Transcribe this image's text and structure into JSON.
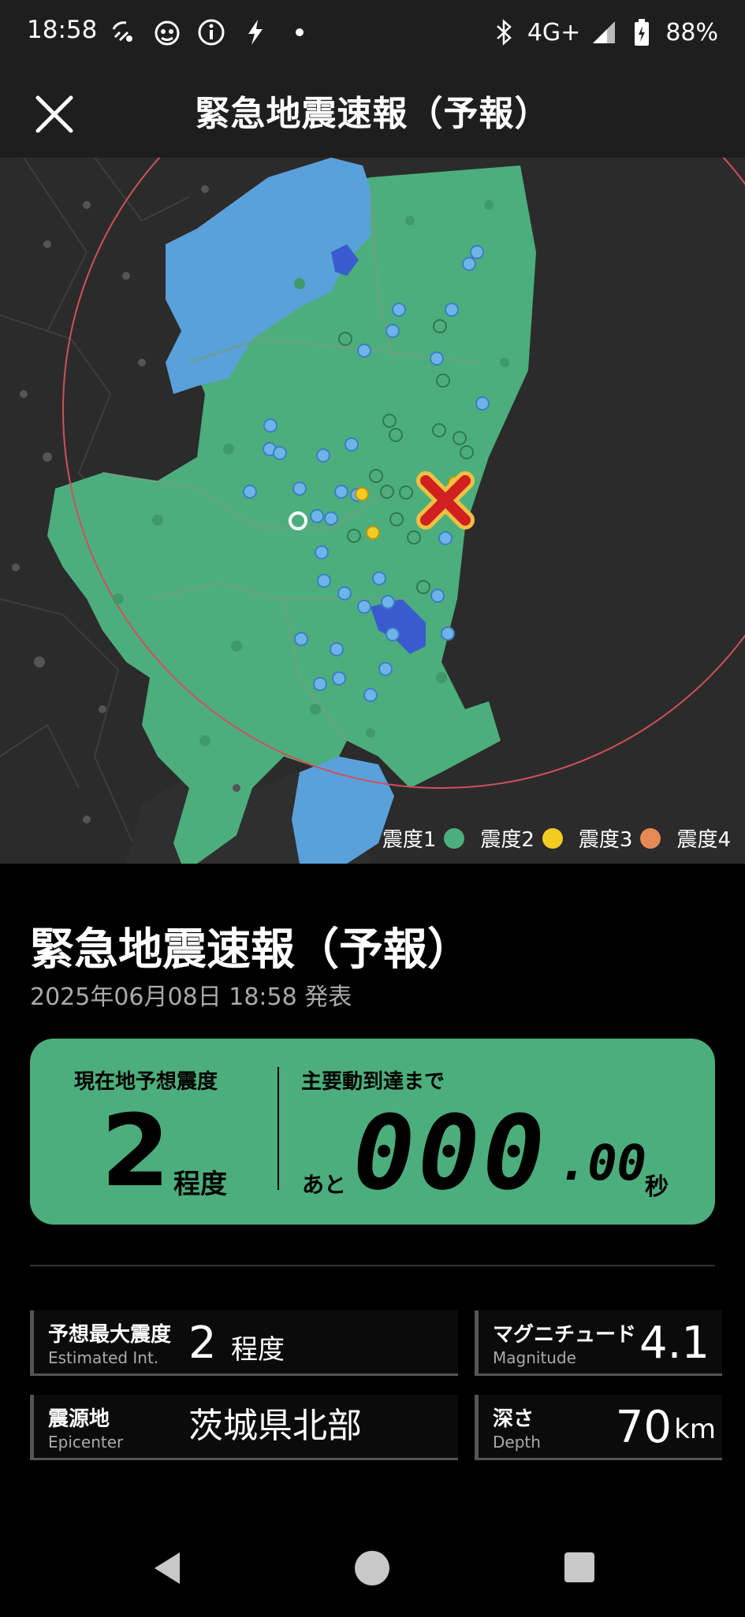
{
  "status_bar": {
    "time": "18:58",
    "network": "4G+",
    "battery": "88%"
  },
  "app_bar": {
    "title": "緊急地震速報（予報）",
    "close_icon": "close-icon"
  },
  "map": {
    "legend": [
      {
        "label": "震度1",
        "color": "#5aa0da"
      },
      {
        "label": "震度2",
        "color": "#4cae7c"
      },
      {
        "label": "震度3",
        "color": "#f2cc22"
      },
      {
        "label": "震度4",
        "color": "#e58a55"
      }
    ]
  },
  "alert": {
    "title": "緊急地震速報（予報）",
    "date": "2025年06月08日 18:58 発表"
  },
  "panel": {
    "intensity_label": "現在地予想震度",
    "intensity_value": "2",
    "intensity_unit": "程度",
    "arrival_label": "主要動到達まで",
    "arrival_prefix": "あと",
    "arrival_int": "000",
    "arrival_dec": ".00",
    "arrival_unit": "秒",
    "bg_color": "#4cae7c"
  },
  "details": {
    "max_int": {
      "label_jp": "予想最大震度",
      "label_en": "Estimated Int.",
      "value": "2",
      "unit": "程度"
    },
    "magnitude": {
      "label_jp": "マグニチュード",
      "label_en": "Magnitude",
      "value": "4.1"
    },
    "epicenter": {
      "label_jp": "震源地",
      "label_en": "Epicenter",
      "value": "茨城県北部"
    },
    "depth": {
      "label_jp": "深さ",
      "label_en": "Depth",
      "value": "70",
      "unit": "km"
    }
  }
}
